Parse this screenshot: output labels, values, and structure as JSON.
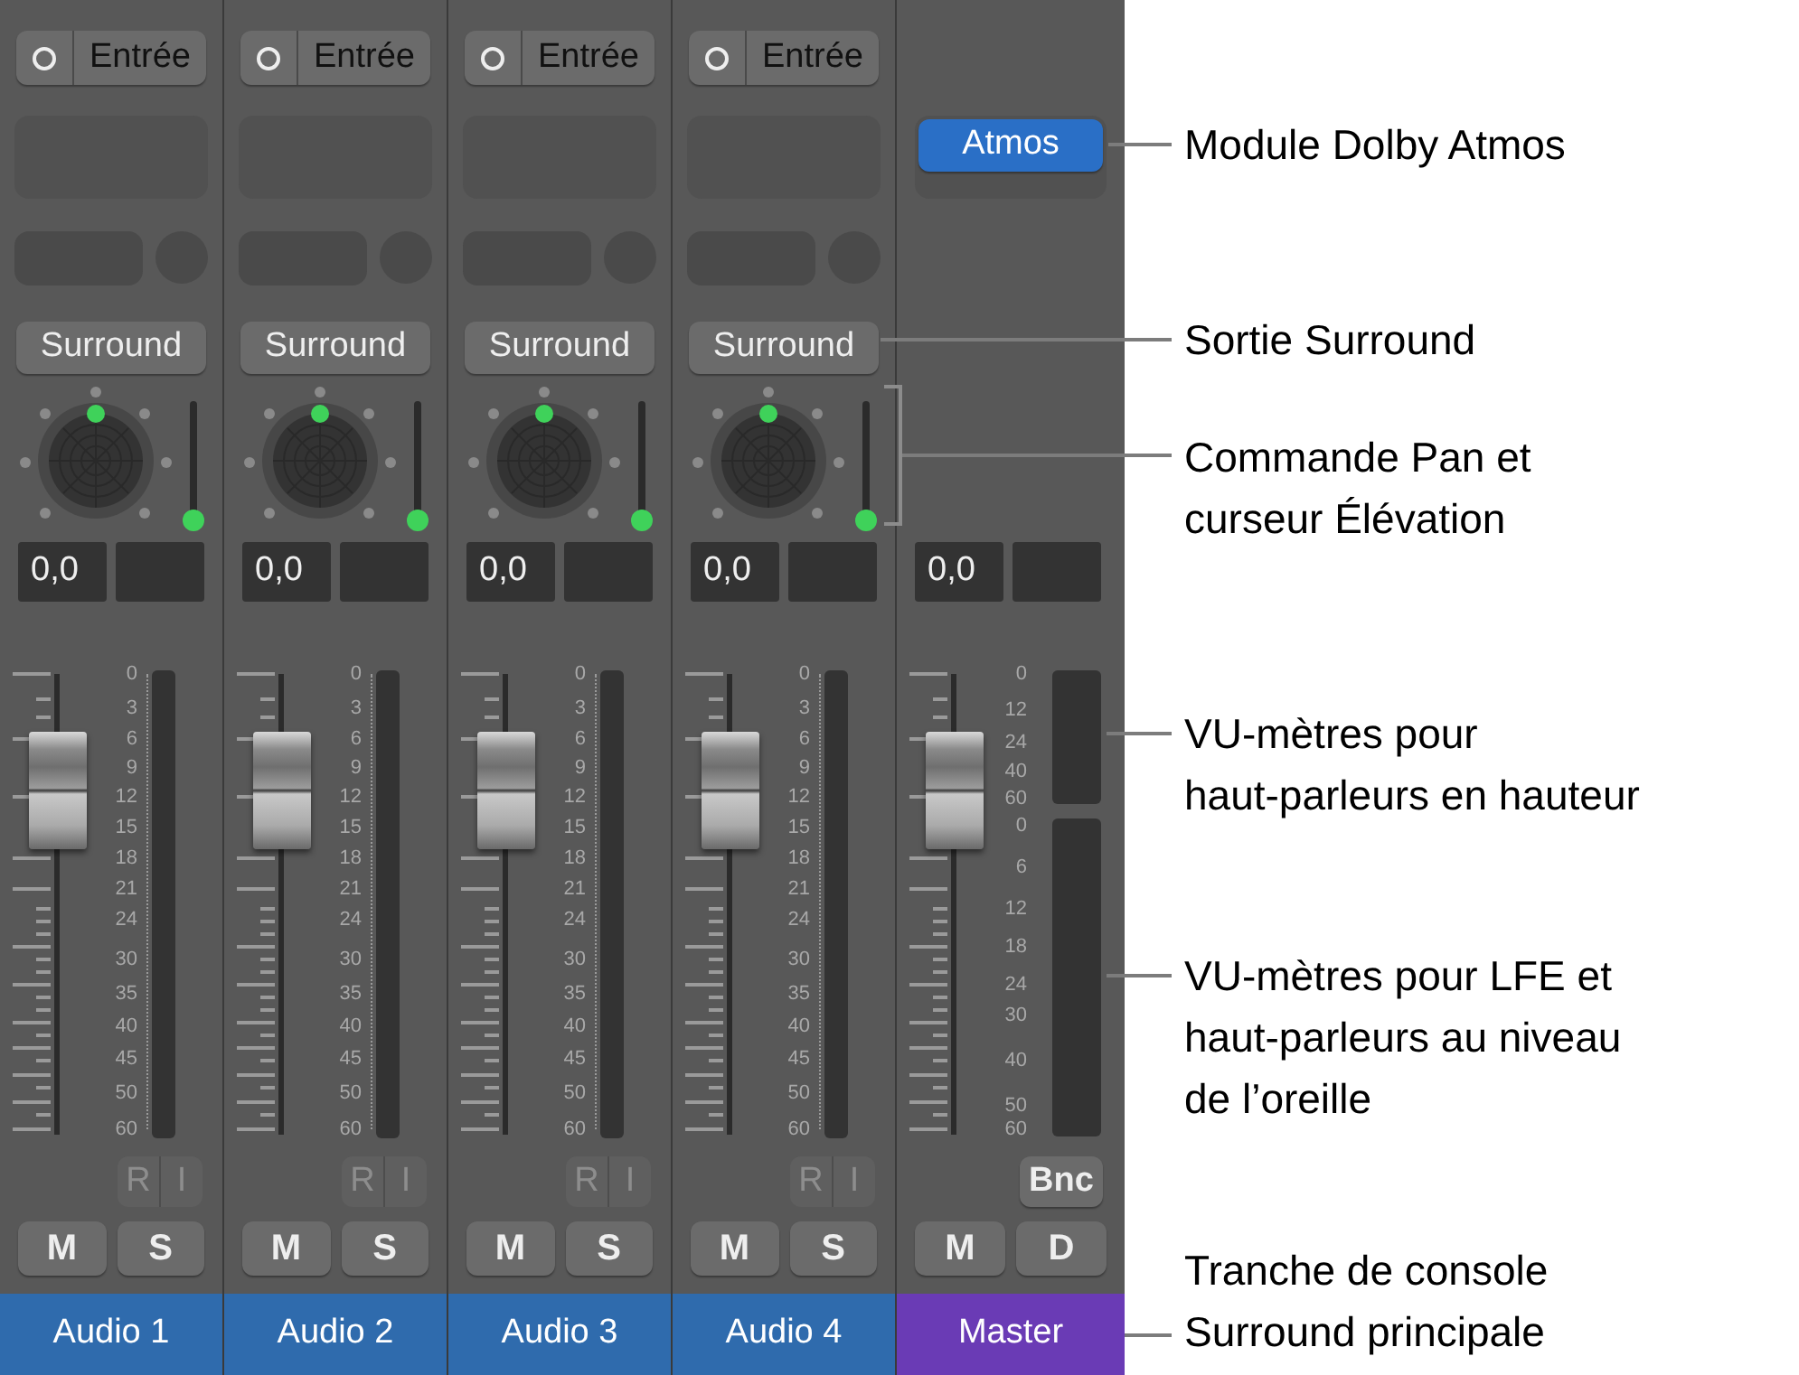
{
  "strips": [
    {
      "kind": "track",
      "input": "Entrée",
      "output": "Surround",
      "elevation": {
        "level": 0
      },
      "pan_value": "0,0",
      "meter_scale": [
        "0",
        "3",
        "6",
        "9",
        "12",
        "15",
        "18",
        "21",
        "24",
        "30",
        "35",
        "40",
        "45",
        "50",
        "60"
      ],
      "input_buttons": [
        "R",
        "I"
      ],
      "buttons": [
        "M",
        "S"
      ],
      "name": "Audio 1",
      "color": "#2f6bad"
    },
    {
      "kind": "track",
      "input": "Entrée",
      "output": "Surround",
      "elevation": {
        "level": 0
      },
      "pan_value": "0,0",
      "meter_scale": [
        "0",
        "3",
        "6",
        "9",
        "12",
        "15",
        "18",
        "21",
        "24",
        "30",
        "35",
        "40",
        "45",
        "50",
        "60"
      ],
      "input_buttons": [
        "R",
        "I"
      ],
      "buttons": [
        "M",
        "S"
      ],
      "name": "Audio 2",
      "color": "#2f6bad"
    },
    {
      "kind": "track",
      "input": "Entrée",
      "output": "Surround",
      "elevation": {
        "level": 0
      },
      "pan_value": "0,0",
      "meter_scale": [
        "0",
        "3",
        "6",
        "9",
        "12",
        "15",
        "18",
        "21",
        "24",
        "30",
        "35",
        "40",
        "45",
        "50",
        "60"
      ],
      "input_buttons": [
        "R",
        "I"
      ],
      "buttons": [
        "M",
        "S"
      ],
      "name": "Audio 3",
      "color": "#2f6bad"
    },
    {
      "kind": "track",
      "input": "Entrée",
      "output": "Surround",
      "elevation": {
        "level": 0
      },
      "pan_value": "0,0",
      "meter_scale": [
        "0",
        "3",
        "6",
        "9",
        "12",
        "15",
        "18",
        "21",
        "24",
        "30",
        "35",
        "40",
        "45",
        "50",
        "60"
      ],
      "input_buttons": [
        "R",
        "I"
      ],
      "buttons": [
        "M",
        "S"
      ],
      "name": "Audio 4",
      "color": "#2f6bad"
    },
    {
      "kind": "master",
      "plugin": "Atmos",
      "pan_value": "0,0",
      "height_meter_scale": [
        "0",
        "12",
        "24",
        "40",
        "60"
      ],
      "ear_meter_scale": [
        "0",
        "6",
        "12",
        "18",
        "24",
        "30",
        "40",
        "50",
        "60"
      ],
      "bounce": "Bnc",
      "buttons": [
        "M",
        "D"
      ],
      "name": "Master",
      "color": "#6a3bb5"
    }
  ],
  "callouts": [
    {
      "text": "Module Dolby Atmos"
    },
    {
      "text": "Sortie Surround"
    },
    {
      "text": "Commande Pan et\ncurseur Élévation"
    },
    {
      "text": "VU-mètres pour\nhaut-parleurs en hauteur"
    },
    {
      "text": "VU-mètres pour LFE et\nhaut-parleurs au niveau\nde l’oreille"
    },
    {
      "text": "Tranche de console\nSurround principale"
    }
  ]
}
